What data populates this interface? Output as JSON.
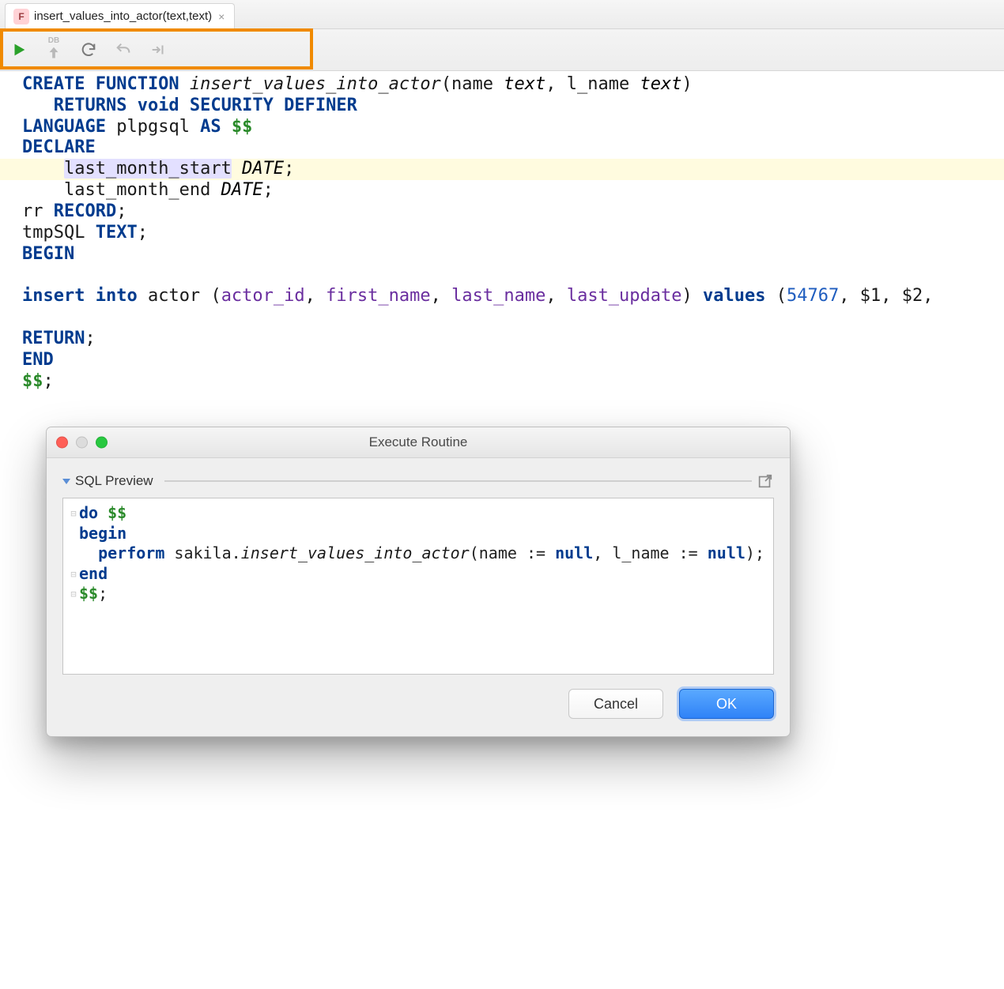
{
  "tab": {
    "icon_letter": "F",
    "title": "insert_values_into_actor(text,text)",
    "close_glyph": "×"
  },
  "toolbar": {
    "db_label": "DB"
  },
  "editor": {
    "l1_create": "CREATE FUNCTION ",
    "l1_fn": "insert_values_into_actor",
    "l1_args_open": "(name ",
    "l1_type1": "text",
    "l1_mid": ", l_name ",
    "l1_type2": "text",
    "l1_close": ")",
    "l2": "   RETURNS void SECURITY DEFINER",
    "l3_lang": "LANGUAGE ",
    "l3_pl": "plpgsql",
    "l3_as": " AS ",
    "l3_sym": "$$",
    "l4": "DECLARE",
    "l5_indent": "    ",
    "l5_var": "last_month_start",
    "l5_type": " DATE",
    "l5_semi": ";",
    "l6_indent": "    ",
    "l6_var": "last_month_end",
    "l6_type": " DATE",
    "l6_semi": ";",
    "l7_var": "rr",
    "l7_type": " RECORD",
    "l7_semi": ";",
    "l8_var": "tmpSQL",
    "l8_type": " TEXT",
    "l8_semi": ";",
    "l9": "BEGIN",
    "l10": "",
    "l11_ins": "insert into ",
    "l11_tbl": "actor ",
    "l11_po": "(",
    "l11_c1": "actor_id",
    "l11_c2": "first_name",
    "l11_c3": "last_name",
    "l11_c4": "last_update",
    "l11_comma": ", ",
    "l11_pc": ")",
    "l11_vals": " values ",
    "l11_vo": "(",
    "l11_num": "54767",
    "l11_r1": ", $1, $2, ",
    "l12": "",
    "l13": "RETURN",
    "l13_semi": ";",
    "l14": "END",
    "l15_sym": "$$",
    "l15_semi": ";"
  },
  "dialog": {
    "title": "Execute Routine",
    "section": "SQL Preview",
    "cancel": "Cancel",
    "ok": "OK",
    "p1_do": "do ",
    "p1_sym": "$$",
    "p2": "begin",
    "p3_indent": "  ",
    "p3_perform": "perform ",
    "p3_schema": "sakila.",
    "p3_fn": "insert_values_into_actor",
    "p3_open": "(name := ",
    "p3_null1": "null",
    "p3_mid": ", l_name := ",
    "p3_null2": "null",
    "p3_close": ");",
    "p4": "end",
    "p5_sym": "$$",
    "p5_semi": ";"
  }
}
